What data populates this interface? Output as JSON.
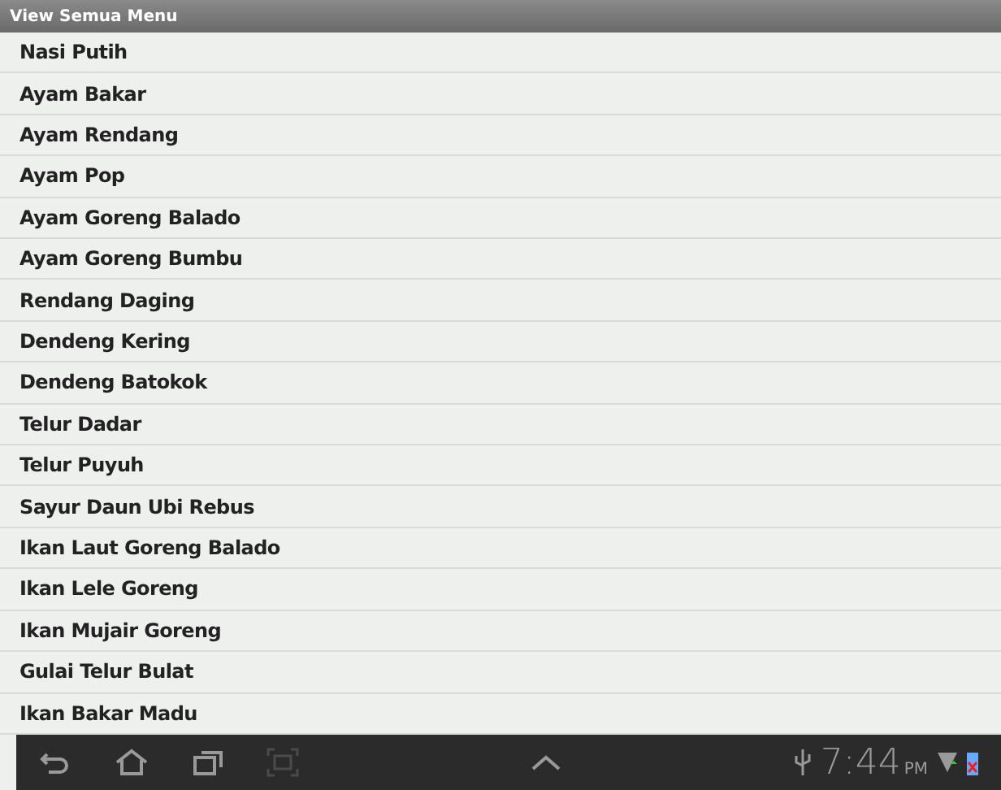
{
  "window": {
    "title": "View Semua Menu"
  },
  "menu_items": [
    "Nasi Putih",
    "Ayam Bakar",
    "Ayam Rendang",
    "Ayam Pop",
    "Ayam Goreng Balado",
    "Ayam Goreng Bumbu",
    "Rendang Daging",
    "Dendeng Kering",
    "Dendeng Batokok",
    "Telur Dadar",
    "Telur Puyuh",
    "Sayur Daun Ubi Rebus",
    "Ikan Laut Goreng Balado",
    "Ikan Lele Goreng",
    "Ikan Mujair Goreng",
    "Gulai Telur Bulat",
    "Ikan Bakar Madu"
  ],
  "status_bar": {
    "time": "7:44",
    "ampm": "PM"
  }
}
